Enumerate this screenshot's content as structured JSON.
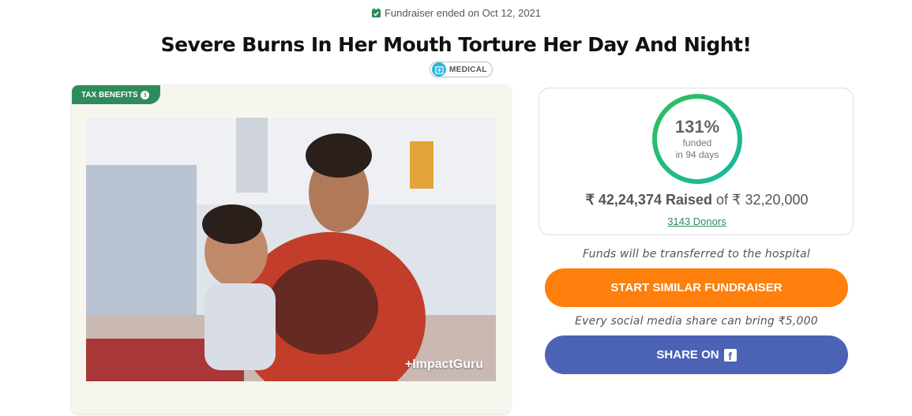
{
  "status": {
    "text": "Fundraiser ended on Oct 12, 2021",
    "icon": "calendar-check-icon"
  },
  "title": "Severe Burns In Her Mouth Torture Her Day And Night!",
  "category": {
    "label": "MEDICAL",
    "icon": "hospital-icon"
  },
  "media": {
    "tax_label": "TAX BENEFITS",
    "watermark": "+ImpactGuru"
  },
  "stats": {
    "percent_text": "131%",
    "percent_value": 1.31,
    "funded_label": "funded",
    "days_label": "in 94 days",
    "raised_amount": "₹ 42,24,374 Raised",
    "goal_text": "of ₹ 32,20,000",
    "donors_text": "3143 Donors"
  },
  "transfer_note": "Funds will be transferred to the hospital",
  "start_button": "START SIMILAR FUNDRAISER",
  "share_note": "Every social media share can bring ₹5,000",
  "share_button": "SHARE ON",
  "colors": {
    "green": "#2e8b5b",
    "orange": "#fe7f0b",
    "blue": "#4c62b5",
    "ring_start": "#2fbf5a",
    "ring_end": "#16b8a0"
  }
}
